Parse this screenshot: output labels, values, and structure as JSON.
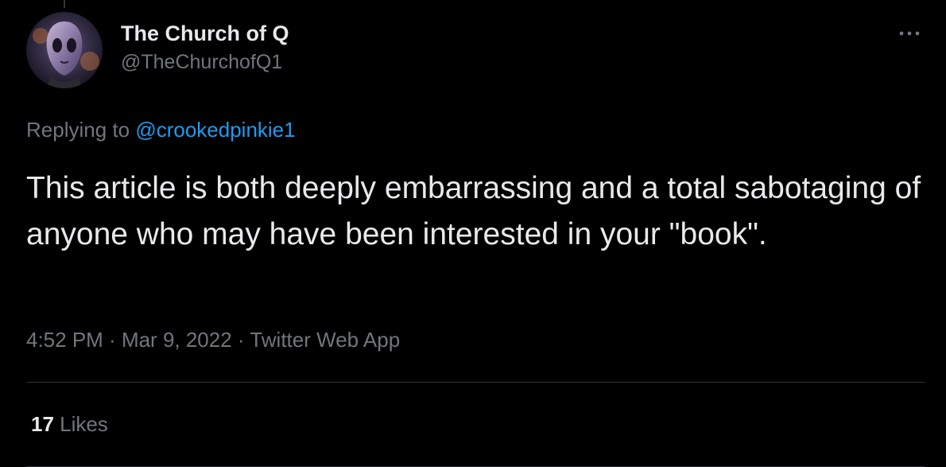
{
  "tweet": {
    "author": {
      "display_name": "The Church of Q",
      "handle": "@TheChurchofQ1",
      "avatar_icon": "alien-portrait-avatar"
    },
    "more_icon": "more-horizontal-icon",
    "reply": {
      "prefix": "Replying to ",
      "mention": "@crookedpinkie1"
    },
    "text": "This article is both deeply embarrassing and a total sabotaging of anyone who may have been interested in your \"book\".",
    "meta": {
      "time": "4:52 PM",
      "separator": " · ",
      "date": "Mar 9, 2022",
      "source": "Twitter Web App"
    },
    "stats": {
      "likes_count": "17",
      "likes_label": " Likes"
    }
  },
  "colors": {
    "background": "#000000",
    "primary_text": "#e7e9ea",
    "secondary_text": "#71767b",
    "accent": "#1d9bf0",
    "divider": "#2f3336"
  }
}
